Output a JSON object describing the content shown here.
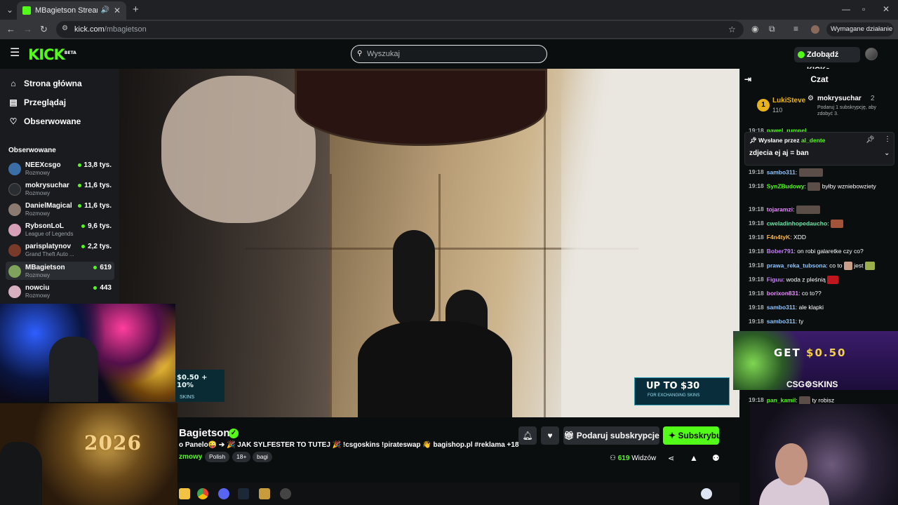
{
  "browser": {
    "tab_title": "MBagietson Stream - Watch",
    "url_host": "kick.com",
    "url_path": "/mbagietson",
    "action_required": "Wymagane działanie"
  },
  "header": {
    "search_placeholder": "Wyszukaj",
    "get_kicks": "Zdobądź KICKs",
    "logo": "KICK",
    "logo_beta": "BETA"
  },
  "sidebar": {
    "nav": [
      {
        "label": "Strona główna",
        "icon": "home-icon"
      },
      {
        "label": "Przeglądaj",
        "icon": "browse-icon"
      },
      {
        "label": "Obserwowane",
        "icon": "heart-icon"
      }
    ],
    "following_header": "Obserwowane",
    "channels": [
      {
        "name": "NEEXcsgo",
        "category": "Rozmowy",
        "viewers": "13,8 tys.",
        "avatar": "#3b6ea5"
      },
      {
        "name": "mokrysuchar",
        "category": "Rozmowy",
        "viewers": "11,6 tys.",
        "avatar": "#2a2d31"
      },
      {
        "name": "DanielMagical",
        "category": "Rozmowy",
        "viewers": "11,6 tys.",
        "avatar": "#8a7a70"
      },
      {
        "name": "RybsonLoL",
        "category": "League of Legends",
        "viewers": "9,6 tys.",
        "avatar": "#d7a0b8"
      },
      {
        "name": "parisplatynov",
        "category": "Grand Theft Auto ...",
        "viewers": "2,2 tys.",
        "avatar": "#7a3a2a"
      },
      {
        "name": "MBagietson",
        "category": "Rozmowy",
        "viewers": "619",
        "avatar": "#7fa35a"
      },
      {
        "name": "nowciu",
        "category": "Rozmowy",
        "viewers": "443",
        "avatar": "#d8b0c0"
      }
    ]
  },
  "player": {
    "ad_right_big": "UP TO $30",
    "ad_right_small": "FOR EXCHANGING SKINS",
    "ad_left_big": "$0.50 + 10%",
    "ad_left_small": "SKINS",
    "overlay_year": "2026"
  },
  "stream_info": {
    "streamer": "Bagietson",
    "title": "o Panelo😜 ➔ 🎉 JAK SYLFESTER TO TUTEJ 🎉 !csgoskins !pirateswap 👋 bagishop.pl #reklama +18",
    "category": "zmowy",
    "tags": [
      "Polish",
      "18+",
      "bagi"
    ],
    "gift_button": "Podaruj subskrypcje",
    "subscribe_button": "Subskrybuj",
    "viewers_count": "619",
    "viewers_label": "Widzów"
  },
  "chat": {
    "title": "Czat",
    "leaderboard": [
      {
        "rank": "1",
        "name": "LukiSteve",
        "amount": "110"
      },
      {
        "name": "mokrysuchar",
        "amount": "2",
        "note": "Podaruj 1 subskrypcję, aby zdobyć 3."
      }
    ],
    "pinned": {
      "prefix": "Wysłane przez",
      "user": "al_dente",
      "text": "zdjecia ej aj = ban"
    },
    "messages": [
      {
        "time": "19:18",
        "user": "pawel_rumpel",
        "color": "#53fc18",
        "text": ""
      },
      {
        "time": "19:18",
        "user": "sambo311",
        "color": "#8ec5ff",
        "text": ""
      },
      {
        "time": "19:18",
        "user": "SynZBudowy",
        "color": "#53fc18",
        "text": "byłby wzniebowziety"
      },
      {
        "time": "19:18",
        "user": "tojaramzi",
        "color": "#e88cff",
        "text": ""
      },
      {
        "time": "19:18",
        "user": "cweladinhopedaucho",
        "color": "#6ee7a8",
        "text": ""
      },
      {
        "time": "19:18",
        "user": "F4n4tyK",
        "color": "#ffb347",
        "text": "XDD"
      },
      {
        "time": "19:18",
        "user": "Bober791",
        "color": "#c77dff",
        "text": "on robi galaretke czy co?"
      },
      {
        "time": "19:18",
        "user": "prawa_reka_tubsona",
        "color": "#8ec5ff",
        "text": "co to"
      },
      {
        "time": "19:18",
        "user": "Figuu",
        "color": "#c77dff",
        "text": "woda z pleśnią"
      },
      {
        "time": "19:18",
        "user": "borixon831",
        "color": "#e88cff",
        "text": "co to??"
      },
      {
        "time": "19:18",
        "user": "sambo311",
        "color": "#8ec5ff",
        "text": "ale klapki"
      },
      {
        "time": "19:18",
        "user": "sambo311",
        "color": "#8ec5ff",
        "text": "ty"
      },
      {
        "time": "19:18",
        "user": "pan_kamil",
        "color": "#53fc18",
        "text": "ty robisz"
      }
    ],
    "ad": {
      "get": "GET",
      "amount": "$0.50",
      "brand": "CSG⚙SKINS"
    }
  },
  "colors": {
    "accent": "#53fc18",
    "bg": "#0b0e0f",
    "panel": "#191b1f"
  }
}
